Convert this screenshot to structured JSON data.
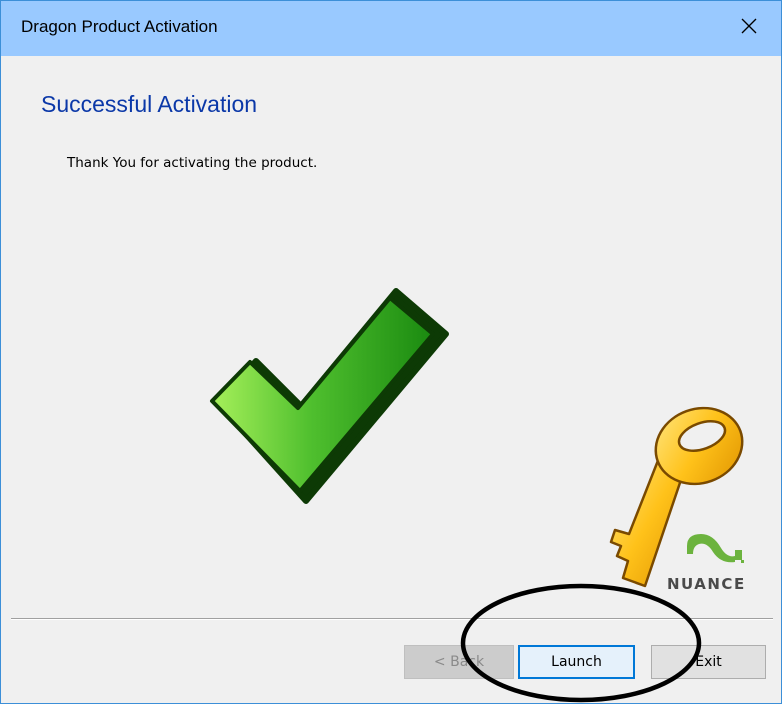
{
  "window": {
    "title": "Dragon Product Activation",
    "close_icon": "close-icon"
  },
  "content": {
    "heading": "Successful Activation",
    "message": "Thank You for activating the product.",
    "checkmark_icon": "checkmark-icon",
    "key_icon": "key-icon"
  },
  "brand": {
    "name": "NUANCE",
    "logo_icon": "nuance-logo-icon",
    "color": "#6cb33e"
  },
  "buttons": {
    "back_label": "< Back",
    "launch_label": "Launch",
    "exit_label": "Exit"
  },
  "colors": {
    "titlebar": "#99c9ff",
    "heading": "#0b38a8",
    "accent": "#0078d7"
  }
}
